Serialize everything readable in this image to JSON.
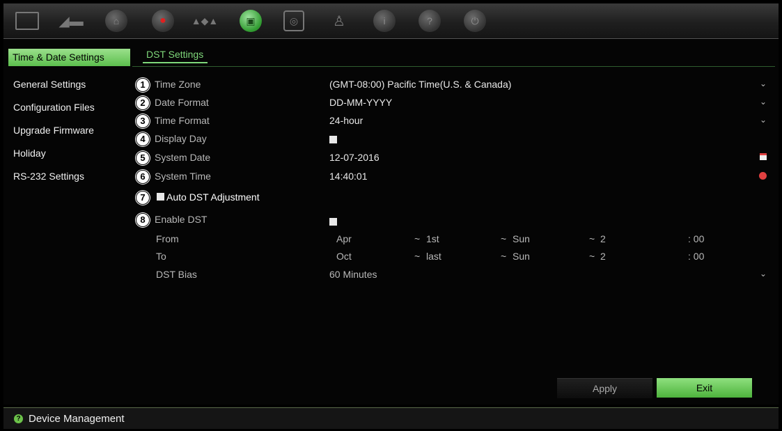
{
  "toolbar": {
    "icons": [
      "monitor-icon",
      "camera-icon",
      "network-icon",
      "record-icon",
      "alarm-icon",
      "device-icon",
      "storage-icon",
      "user-icon",
      "info-icon",
      "help-icon",
      "power-icon"
    ]
  },
  "sidebar": {
    "items": [
      {
        "label": "Time & Date Settings"
      },
      {
        "label": "General Settings"
      },
      {
        "label": "Configuration Files"
      },
      {
        "label": "Upgrade Firmware"
      },
      {
        "label": "Holiday"
      },
      {
        "label": "RS-232 Settings"
      }
    ]
  },
  "tab": {
    "label": "DST Settings"
  },
  "form": {
    "time_zone": {
      "num": "1",
      "label": "Time Zone",
      "value": "(GMT-08:00) Pacific Time(U.S. & Canada)"
    },
    "date_format": {
      "num": "2",
      "label": "Date Format",
      "value": "DD-MM-YYYY"
    },
    "time_format": {
      "num": "3",
      "label": "Time Format",
      "value": "24-hour"
    },
    "display_day": {
      "num": "4",
      "label": "Display Day"
    },
    "system_date": {
      "num": "5",
      "label": "System Date",
      "value": "12-07-2016"
    },
    "system_time": {
      "num": "6",
      "label": "System Time",
      "value": "14:40:01"
    },
    "auto_dst": {
      "num": "7",
      "label": "Auto DST Adjustment"
    },
    "enable_dst": {
      "num": "8",
      "label": "Enable DST"
    },
    "from": {
      "label": "From",
      "month": "Apr",
      "week": "1st",
      "day": "Sun",
      "hour": "2",
      "minute": ": 00"
    },
    "to": {
      "label": "To",
      "month": "Oct",
      "week": "last",
      "day": "Sun",
      "hour": "2",
      "minute": ": 00"
    },
    "dst_bias": {
      "label": "DST Bias",
      "value": "60 Minutes"
    }
  },
  "buttons": {
    "apply": "Apply",
    "exit": "Exit"
  },
  "status": {
    "text": "Device Management",
    "icon": "?"
  },
  "glyphs": {
    "chevron": "⌄",
    "dash": "~"
  }
}
